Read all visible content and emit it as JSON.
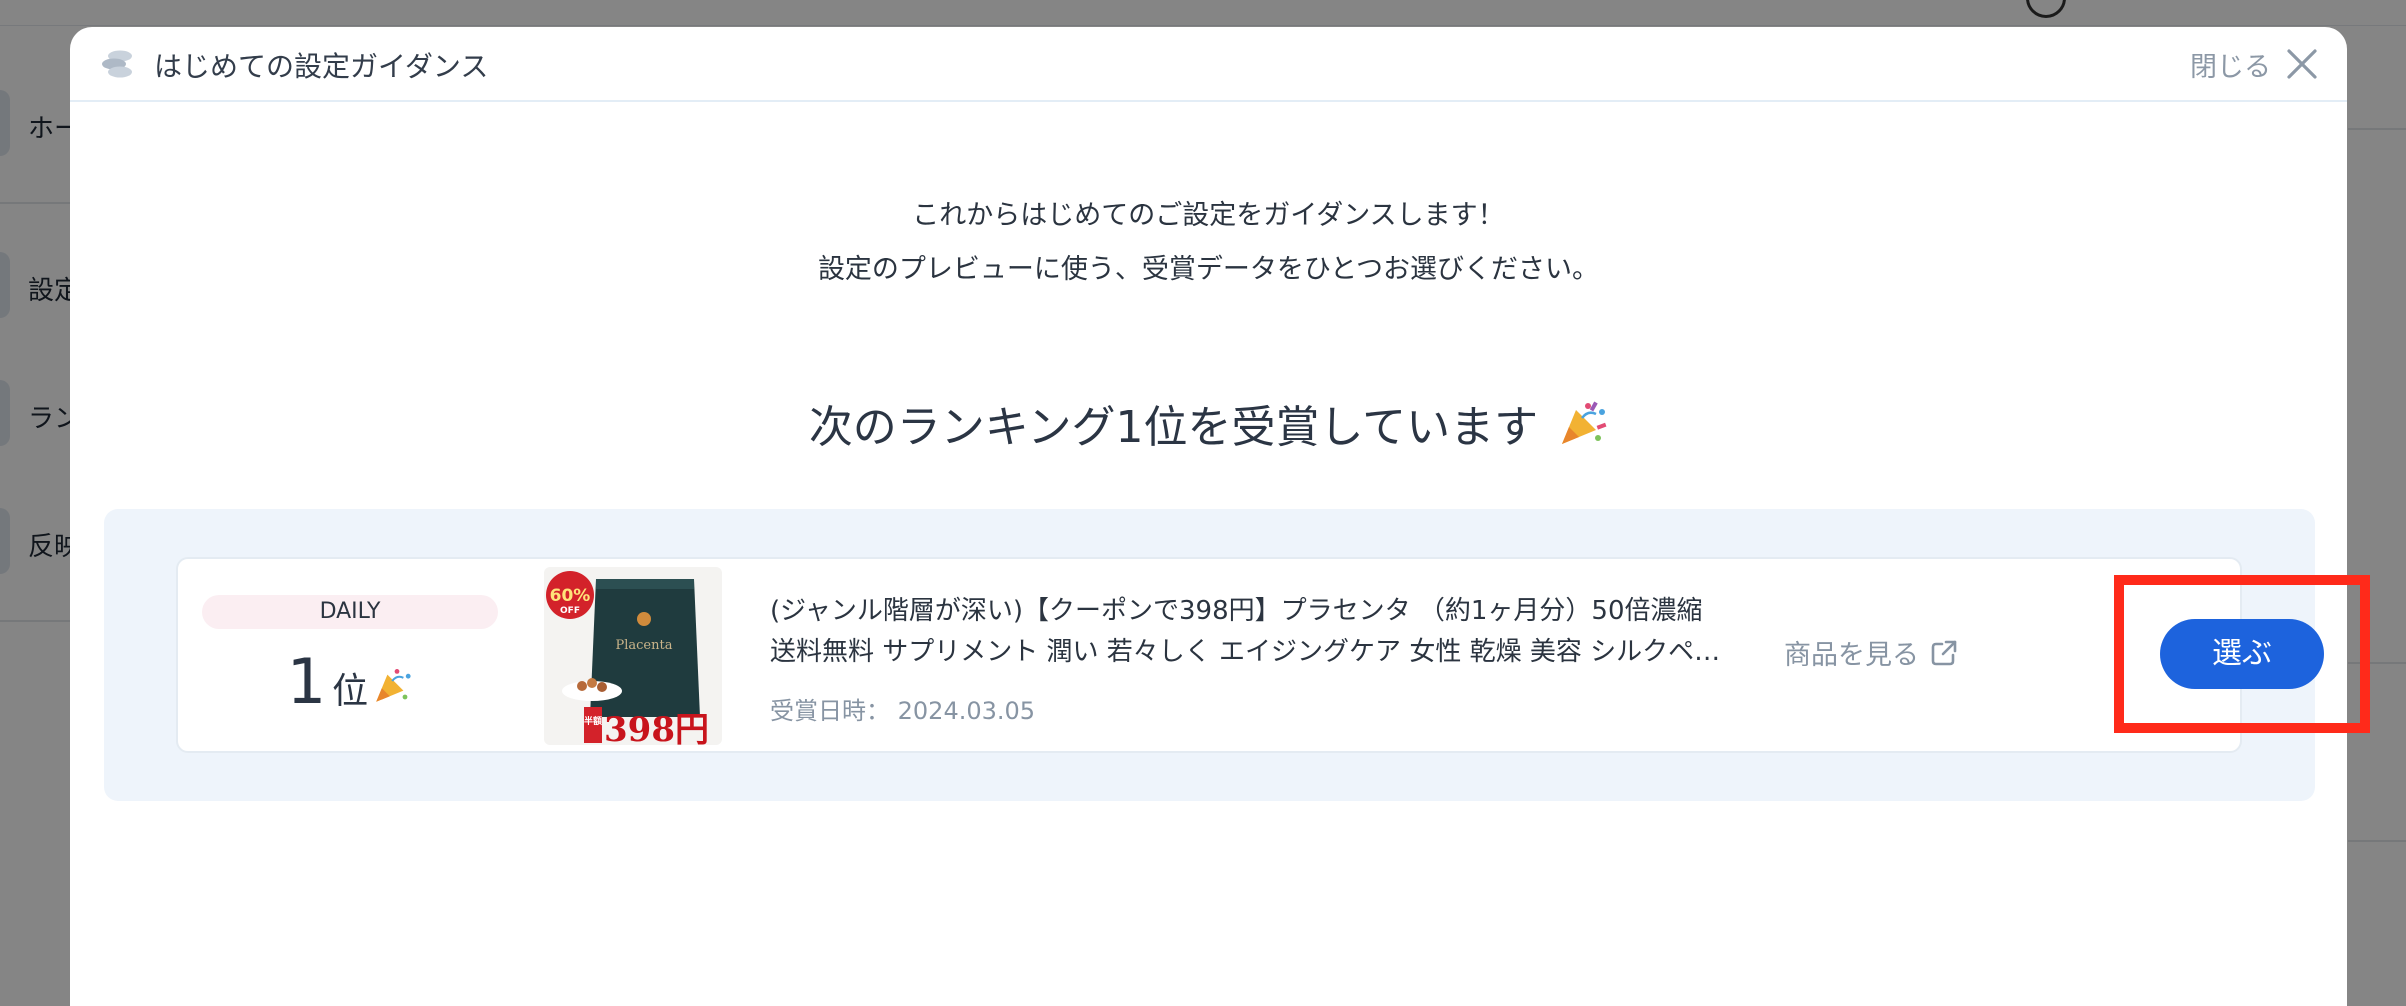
{
  "background": {
    "sidebar_items": [
      "ホー",
      "設定",
      "ラン",
      "反映"
    ]
  },
  "modal": {
    "title": "はじめての設定ガイダンス",
    "close_label": "閉じる",
    "intro_line_1": "これからはじめてのご設定をガイダンスします！",
    "intro_line_2": "設定のプレビューに使う、受賞データをひとつお選びください。",
    "headline": "次のランキング1位を受賞しています",
    "award": {
      "period": "DAILY",
      "rank_number": "1",
      "rank_suffix": "位",
      "product_thumbnail": {
        "badge_text": "60%",
        "badge_sub": "OFF",
        "price_text": "398円",
        "half_price_tag": "半額",
        "brand_text": "Placenta"
      },
      "product_title_line_1": "(ジャンル階層が深い)【クーポンで398円】プラセンタ （約1ヶ月分）50倍濃縮",
      "product_title_line_2": "送料無料 サプリメント 潤い 若々しく エイジングケア 女性 乾燥 美容 シルクペ…",
      "award_date_label": "受賞日時：",
      "award_date": "2024.03.05",
      "view_product_label": "商品を見る",
      "select_button_label": "選ぶ"
    }
  },
  "colors": {
    "primary_button": "#1d63dd",
    "highlight_box": "#ff2a1a",
    "panel_bg": "#eef4fb",
    "badge_bg": "#fbeef2"
  },
  "icons": {
    "logo": "app-logo-icon",
    "close": "close-icon",
    "party": "party-popper-icon",
    "external": "external-link-icon"
  }
}
